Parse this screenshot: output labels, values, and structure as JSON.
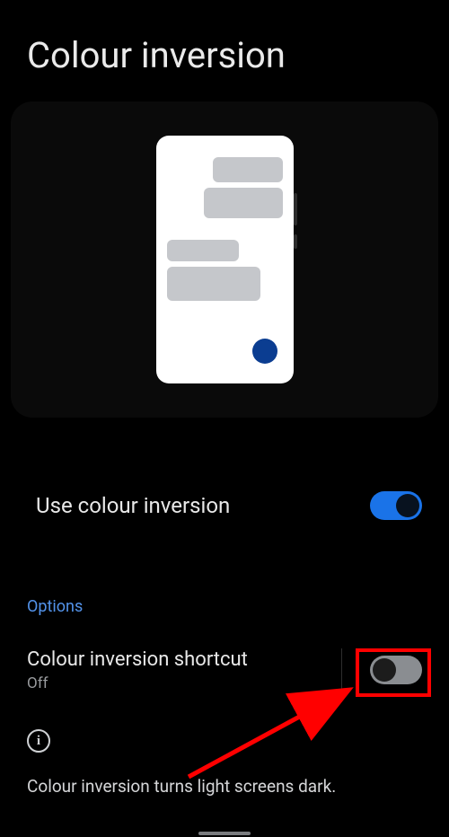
{
  "page": {
    "title": "Colour inversion"
  },
  "settings": {
    "use_label": "Use colour inversion"
  },
  "options": {
    "header": "Options",
    "shortcut_label": "Colour inversion shortcut",
    "shortcut_state": "Off"
  },
  "footer": {
    "text": "Colour inversion turns light screens dark."
  }
}
